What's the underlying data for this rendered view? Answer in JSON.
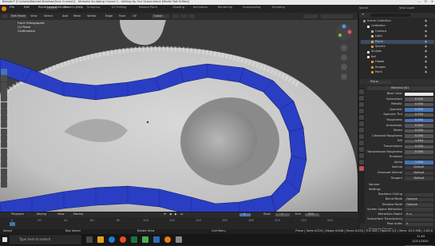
{
  "window": {
    "title": "Blender* [C:\\Users\\Blender\\Desktop\\Face Curves2] - Ultimate Sculpting Course 2 - Setting Up Our Scene.blend [Model Talk Edited]"
  },
  "menus": [
    "File",
    "Edit",
    "Render",
    "Window",
    "Help"
  ],
  "workspaces": [
    "Layout",
    "Modeling",
    "Sculpting",
    "UV Editing",
    "Texture Paint",
    "Shading",
    "Animation",
    "Rendering",
    "Compositing",
    "Scripting"
  ],
  "active_workspace": "Layout",
  "viewport_header": {
    "mode": "Edit Mode",
    "menus": [
      "View",
      "Select",
      "Add",
      "Mesh",
      "Vertex",
      "Edge",
      "Face",
      "UV"
    ],
    "transform": "Global"
  },
  "viewport_overlay": {
    "view_name": "Front Orthographic",
    "collection": "(1) Plane",
    "units": "Centimeters"
  },
  "outliner": {
    "title": "Scene Collection",
    "items": [
      {
        "label": "Scene Collection",
        "indent": 0,
        "selected": false
      },
      {
        "label": "Collection",
        "indent": 1,
        "selected": false
      },
      {
        "label": "Camera",
        "indent": 2,
        "selected": false
      },
      {
        "label": "Light",
        "indent": 2,
        "selected": false
      },
      {
        "label": "Plane",
        "indent": 2,
        "selected": true
      },
      {
        "label": "Sphere",
        "indent": 2,
        "selected": false
      },
      {
        "label": "Sculpts",
        "indent": 1,
        "selected": false
      },
      {
        "label": "Ref",
        "indent": 1,
        "selected": false
      },
      {
        "label": "Heads",
        "indent": 2,
        "selected": false
      },
      {
        "label": "Images",
        "indent": 2,
        "selected": false
      },
      {
        "label": "Paint",
        "indent": 2,
        "selected": false
      }
    ]
  },
  "properties": {
    "object_name": "Plane",
    "material_name": "Material.001",
    "rows": [
      {
        "label": "Base Color",
        "value": "",
        "kind": "white"
      },
      {
        "label": "Subsurface",
        "value": "0.000",
        "kind": "num"
      },
      {
        "label": "Metallic",
        "value": "0.000",
        "kind": "num"
      },
      {
        "label": "Specular",
        "value": "0.500",
        "kind": "blue"
      },
      {
        "label": "Specular Tint",
        "value": "0.000",
        "kind": "num"
      },
      {
        "label": "Roughness",
        "value": "0.500",
        "kind": "blue"
      },
      {
        "label": "Anisotropic",
        "value": "0.000",
        "kind": "num"
      },
      {
        "label": "Sheen",
        "value": "0.000",
        "kind": "num"
      },
      {
        "label": "Clearcoat Roughness",
        "value": "0.030",
        "kind": "num"
      },
      {
        "label": "IOR",
        "value": "1.450",
        "kind": "num"
      },
      {
        "label": "Transmission",
        "value": "0.000",
        "kind": "num"
      },
      {
        "label": "Transmission Roughness",
        "value": "0.000",
        "kind": "num"
      },
      {
        "label": "Emission",
        "value": "",
        "kind": "dark"
      },
      {
        "label": "Alpha",
        "value": "1.000",
        "kind": "blue"
      },
      {
        "label": "Normal",
        "value": "Default",
        "kind": "dark"
      },
      {
        "label": "Clearcoat Normal",
        "value": "Default",
        "kind": "dark"
      },
      {
        "label": "Tangent",
        "value": "Default",
        "kind": "dark"
      }
    ],
    "sections": [
      "Volume",
      "Settings"
    ],
    "settings": [
      {
        "label": "Backface Culling",
        "value": ""
      },
      {
        "label": "Blend Mode",
        "value": "Opaque"
      },
      {
        "label": "Shadow Mode",
        "value": "Opaque"
      },
      {
        "label": "Screen Space Refraction",
        "value": ""
      },
      {
        "label": "Refraction Depth",
        "value": "0 m"
      },
      {
        "label": "Subsurface Translucency",
        "value": ""
      },
      {
        "label": "Pass Index",
        "value": "0"
      }
    ],
    "viewport_display": {
      "header": "Viewport Display",
      "rows": [
        "Color",
        "Metallic",
        "Roughness"
      ]
    }
  },
  "timeline": {
    "menus": [
      "Playback",
      "Keying",
      "View",
      "Marker"
    ],
    "current_frame": "1",
    "start": "1",
    "end": "250",
    "ticks": [
      "0",
      "20",
      "40",
      "60",
      "80",
      "100",
      "120",
      "140",
      "160",
      "180",
      "200",
      "220",
      "240"
    ]
  },
  "statusbar": {
    "left": [
      "Select",
      "Box Select",
      "Rotate View",
      "Call Menu"
    ],
    "right": "Plane | Verts 0/224 | Edges 0/448 | Faces 0/224 | Tris 448 | Objects 1/5 | Mem: 43.5 MiB | 2.83.0"
  },
  "taskbar": {
    "search": "Type here to search",
    "time": "11:05",
    "date": "12/11/2020"
  },
  "colors": {
    "accent": "#4772b3",
    "selection": "#3d4a63",
    "viewport_bg": "#3d3d3d",
    "band_blue": "#2a3ec4"
  }
}
